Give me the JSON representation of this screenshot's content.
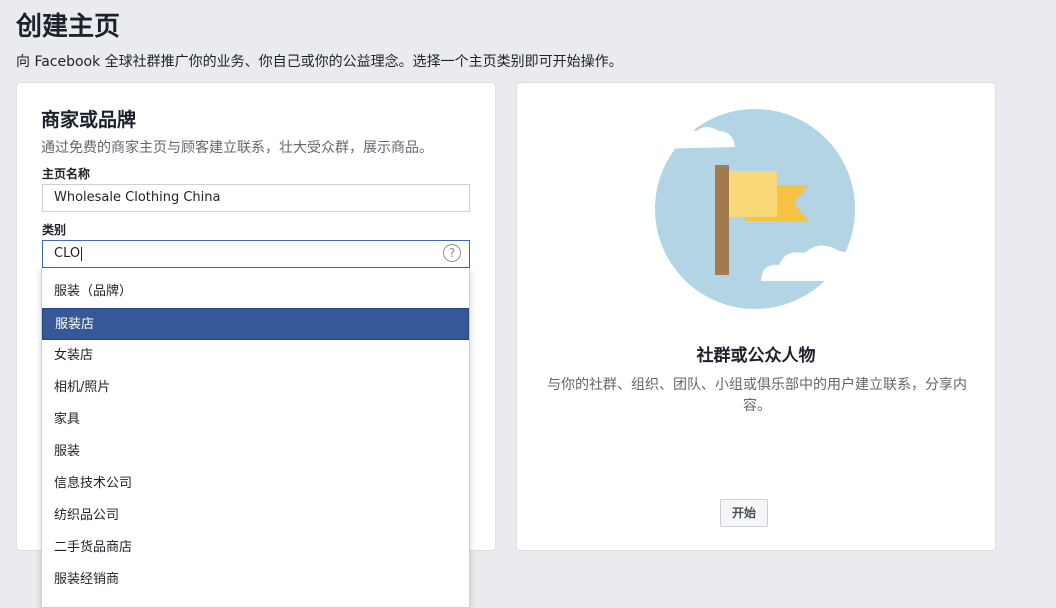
{
  "page": {
    "title": "创建主页",
    "subtitle": "向 Facebook 全球社群推广你的业务、你自己或你的公益理念。选择一个主页类别即可开始操作。"
  },
  "business": {
    "title": "商家或品牌",
    "description": "通过免费的商家主页与顾客建立联系，壮大受众群，展示商品。",
    "page_name_label": "主页名称",
    "page_name_value": "Wholesale Clothing China",
    "category_label": "类别",
    "category_value": "CLO",
    "help_glyph": "?"
  },
  "dropdown": {
    "items": [
      "服装（品牌）",
      "服装店",
      "女装店",
      "相机/照片",
      "家具",
      "服装",
      "信息技术公司",
      "纺织品公司",
      "二手货品商店",
      "服装经销商"
    ],
    "selected_index": 1
  },
  "community": {
    "title": "社群或公众人物",
    "description": "与你的社群、组织、团队、小组或俱乐部中的用户建立联系，分享内容。",
    "start_button": "开始"
  },
  "colors": {
    "background": "#e9ebee",
    "selected_item": "#365899",
    "focus_border": "#4267b2",
    "illustration_circle": "#b3d4e5",
    "flag_pole": "#a17a4f",
    "flag_front": "#f9d87a",
    "flag_back": "#f5c243"
  }
}
